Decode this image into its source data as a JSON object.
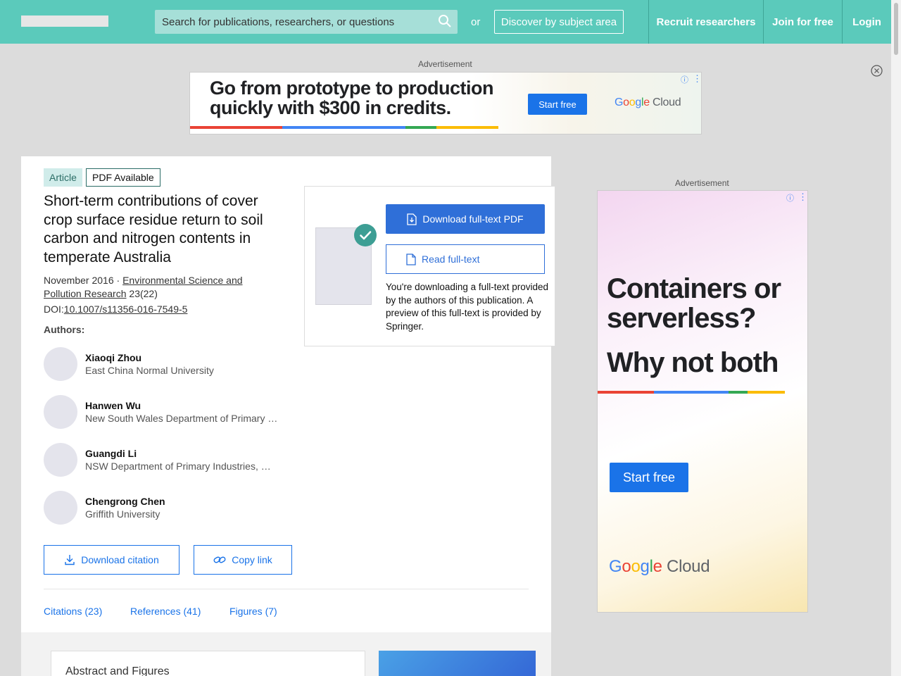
{
  "header": {
    "search_placeholder": "Search for publications, researchers, or questions",
    "or_label": "or",
    "discover_label": "Discover by subject area",
    "recruit_label": "Recruit researchers",
    "join_label": "Join for free",
    "login_label": "Login"
  },
  "ads": {
    "label": "Advertisement",
    "top": {
      "headline": "Go from prototype to production quickly with $300 in credits.",
      "cta": "Start free",
      "brand": "Google Cloud"
    },
    "side": {
      "headline": "Containers or serverless?",
      "headline2": "Why not both",
      "cta": "Start free",
      "brand": "Google Cloud"
    },
    "info_glyph": "ⓘ",
    "menu_glyph": "⋮"
  },
  "publication": {
    "type_badge": "Article",
    "pdf_badge": "PDF Available",
    "title": "Short-term contributions of cover crop surface residue return to soil carbon and nitrogen contents in temperate Australia",
    "date": "November 2016",
    "separator": "·",
    "journal": "Environmental Science and Pollution Research",
    "volume": "23(22)",
    "doi_label": "DOI:",
    "doi": "10.1007/s11356-016-7549-5",
    "authors_label": "Authors:",
    "authors": [
      {
        "name": "Xiaoqi Zhou",
        "affiliation": "East China Normal University"
      },
      {
        "name": "Hanwen Wu",
        "affiliation": "New South Wales Department of Primary Industries"
      },
      {
        "name": "Guangdi Li",
        "affiliation": "NSW Department of Primary Industries, Wagga Wagga"
      },
      {
        "name": "Chengrong Chen",
        "affiliation": "Griffith University"
      }
    ],
    "download_citation_label": "Download citation",
    "copy_link_label": "Copy link",
    "tabs": [
      {
        "label": "Citations (23)"
      },
      {
        "label": "References (41)"
      },
      {
        "label": "Figures (7)"
      }
    ],
    "abstract_heading": "Abstract and Figures"
  },
  "download_panel": {
    "primary_label": "Download full-text PDF",
    "secondary_label": "Read full-text",
    "note": "You're downloading a full-text provided by the authors of this publication. A preview of this full-text is provided by Springer."
  },
  "colors": {
    "header_bg": "#5bcabb",
    "accent_blue": "#1a73e8",
    "badge_green": "#2b6d66",
    "check_green": "#3d9e94"
  }
}
